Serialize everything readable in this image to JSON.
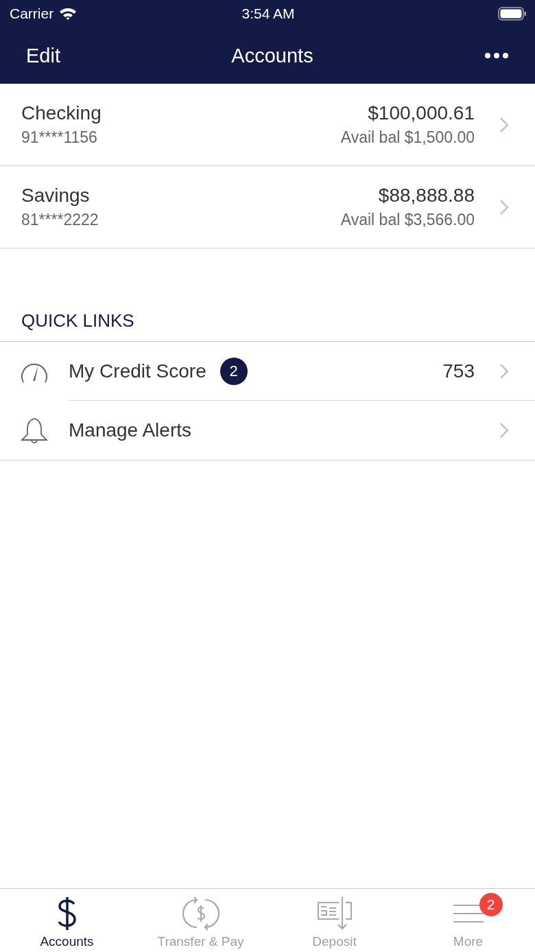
{
  "status_bar": {
    "carrier": "Carrier",
    "time": "3:54 AM"
  },
  "nav_bar": {
    "left": "Edit",
    "title": "Accounts"
  },
  "accounts": [
    {
      "name": "Checking",
      "number": "91****1156",
      "balance": "$100,000.61",
      "available": "Avail bal $1,500.00"
    },
    {
      "name": "Savings",
      "number": "81****2222",
      "balance": "$88,888.88",
      "available": "Avail bal $3,566.00"
    }
  ],
  "quick_links": {
    "heading": "QUICK LINKS",
    "items": [
      {
        "kind": "gauge",
        "label": "My Credit Score",
        "badge": "2",
        "value": "753"
      },
      {
        "kind": "bell",
        "label": "Manage Alerts"
      }
    ]
  },
  "tab_bar": [
    {
      "kind": "dollar",
      "label": "Accounts",
      "selected": true
    },
    {
      "kind": "transfer",
      "label": "Transfer & Pay",
      "selected": false
    },
    {
      "kind": "deposit",
      "label": "Deposit",
      "selected": false
    },
    {
      "kind": "menu",
      "label": "More",
      "selected": false,
      "badge": "2"
    }
  ]
}
